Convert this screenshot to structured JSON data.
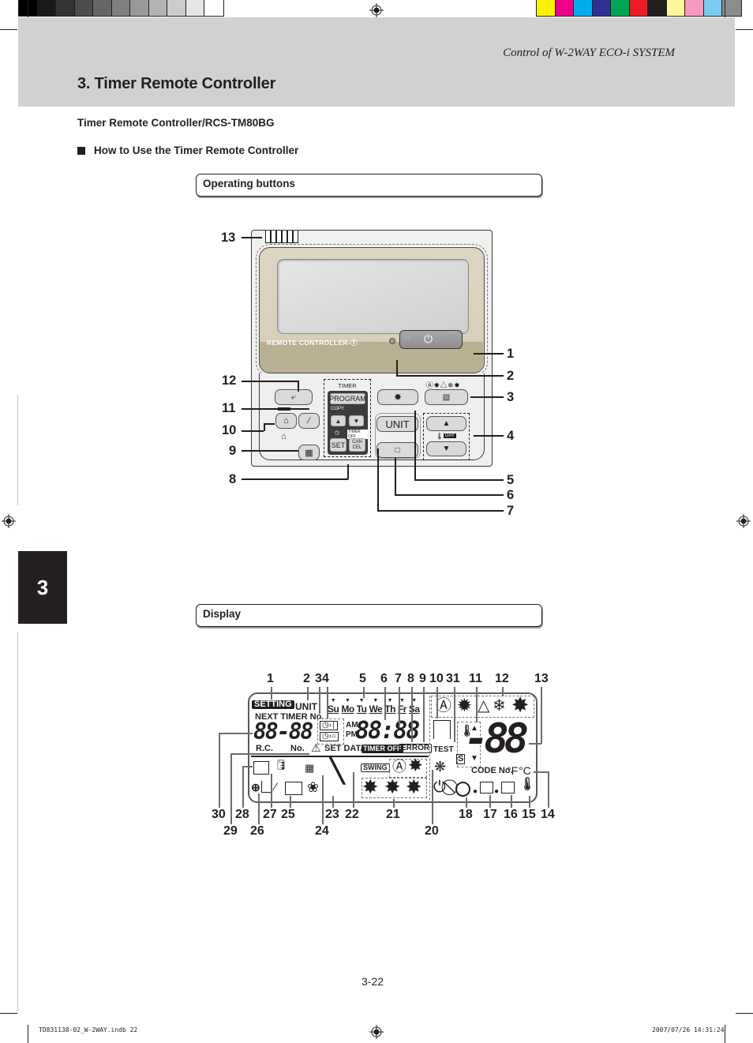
{
  "print_marks": {
    "gray_swatches": [
      "#000000",
      "#1a1a1a",
      "#333333",
      "#4d4d4d",
      "#666666",
      "#808080",
      "#999999",
      "#b3b3b3",
      "#cccccc",
      "#e6e6e6",
      "#ffffff"
    ],
    "color_swatches": [
      "#fff200",
      "#ec008c",
      "#00aeef",
      "#2e3192",
      "#00a651",
      "#ed1c24",
      "#231f20",
      "#fff79a",
      "#f49ac1",
      "#7accf0",
      "#8c8c8c"
    ]
  },
  "header": {
    "running_head": "Control of W-2WAY ECO-i SYSTEM",
    "section_title": "3. Timer Remote Controller",
    "band_color": "#d1d1d1"
  },
  "subtitle": "Timer Remote Controller/RCS-TM80BG",
  "howto_heading": "How to Use the Timer Remote Controller",
  "chapter_tab": "3",
  "operating_section": {
    "heading": "Operating buttons",
    "remote": {
      "brand_label": "REMOTE CONTROLLER-Ⓣ",
      "timer_label": "TIMER",
      "program_label": "PROGRAM",
      "copy_label": "COPY",
      "timer_off_label": "TIMER OFF",
      "set_label": "SET",
      "cancel_label": "CAN CEL",
      "unit_label": "UNIT",
      "day_label": "DAY",
      "mode_icons": "Ⓐ✹△❄✸",
      "up_arrow": "▲",
      "down_arrow": "▼",
      "power_symbol": "⏻"
    },
    "callouts": [
      "1",
      "2",
      "3",
      "4",
      "5",
      "6",
      "7",
      "8",
      "9",
      "10",
      "11",
      "12",
      "13"
    ]
  },
  "display_section": {
    "heading": "Display",
    "lcd": {
      "setting": "SETTING",
      "unit": "UNIT",
      "next_timer": "NEXT TIMER No.",
      "days": [
        "Su",
        "Mo",
        "Tu",
        "We",
        "Th",
        "Fr",
        "Sa"
      ],
      "seg_left": "88-88",
      "seg_time": "88:88",
      "am": "AM",
      "pm": "PM",
      "rc": "R.C.",
      "no": "No.",
      "set_data": "SET DATA",
      "timer_off": "TIMER OFF",
      "error": "ERROR",
      "swing": "SWING",
      "test": "TEST",
      "code_no": "CODE No.",
      "deg_f": "°F",
      "deg_c": "°C",
      "seg_big": "-88",
      "warning_symbol": "⚠",
      "timer_on_symbol": "◷›∣",
      "timer_off_symbol": "◷›○",
      "mode_auto": "Ⓐ",
      "mode_heat": "✹",
      "mode_dry": "△",
      "mode_cool": "❄",
      "mode_fan": "✸"
    },
    "top_callouts": [
      "1",
      "2",
      "3",
      "4",
      "5",
      "6",
      "7",
      "8",
      "9",
      "10",
      "31",
      "11",
      "12",
      "13"
    ],
    "bottom_callouts_row1": [
      "30",
      "28",
      "27",
      "25",
      "23",
      "22",
      "21",
      "18",
      "17",
      "16",
      "15",
      "14"
    ],
    "bottom_callouts_row2": [
      "29",
      "26",
      "24",
      "20"
    ]
  },
  "footer": {
    "page_number": "3-22",
    "file_name": "TD831138-02_W-2WAY.indb   22",
    "date_time": "2007/07/26   14:31:24"
  }
}
